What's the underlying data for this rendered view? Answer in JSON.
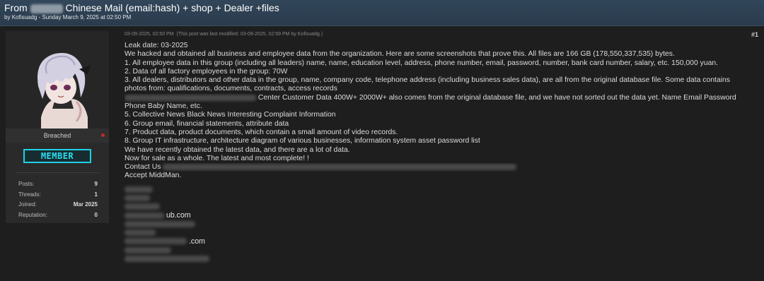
{
  "thread": {
    "title_prefix": "From",
    "title_suffix": "Chinese Mail (email:hash) + shop + Dealer +files",
    "author_prefix": "by",
    "author": "Kofisuadg",
    "date": "Sunday March 9, 2025 at 02:50 PM"
  },
  "post": {
    "timestamp": "03-09-2025, 02:50 PM",
    "modified_note": "(This post was last modified: 03-09-2025, 02:59 PM by Kofisuadg.)",
    "number": "#1",
    "lines": [
      "Leak date: 03-2025",
      "We hacked and obtained all business and employee data from the organization. Here are some screenshots that prove this. All files are 166 GB (178,550,337,535) bytes.",
      "1. All employee data in this group (including all leaders) name, name, education level, address, phone number, email, password, number, bank card number, salary, etc. 150,000 yuan.",
      "2. Data of all factory employees in the group: 70W",
      "3. All dealers, distributors and other data in the group, name, company code, telephone address (including business sales data), are all from the original database file. Some data contains",
      "photos from: qualifications, documents, contracts, access records",
      "Center Customer Data 400W+ 2000W+ also comes from the original database file, and we have not sorted out the data yet. Name Email Password",
      "Phone Baby Name, etc.",
      "5. Collective News Black News Interesting Complaint Information",
      "6. Group email, financial statements, attribute data",
      "7. Product data, product documents, which contain a small amount of video records.",
      "8. Group IT infrastructure, architecture diagram of various businesses, information system asset password list",
      "We have recently obtained the latest data, and there are a lot of data.",
      "Now for sale as a whole. The latest and most complete! !",
      "Contact Us",
      "Accept MiddMan."
    ],
    "contacts": [
      "",
      "",
      "",
      "ub.com",
      "",
      "",
      ".com",
      "",
      ""
    ]
  },
  "user": {
    "status": "Breached",
    "rank": "MEMBER",
    "stats": [
      {
        "label": "Posts:",
        "value": "9"
      },
      {
        "label": "Threads:",
        "value": "1"
      },
      {
        "label": "Joined:",
        "value": "Mar 2025"
      },
      {
        "label": "Reputation:",
        "value": "0"
      }
    ]
  },
  "colors": {
    "header": "#2e4154",
    "body_bg": "#1e1e1e",
    "badge": "#1ed1e6",
    "status_dot": "#c62828"
  }
}
